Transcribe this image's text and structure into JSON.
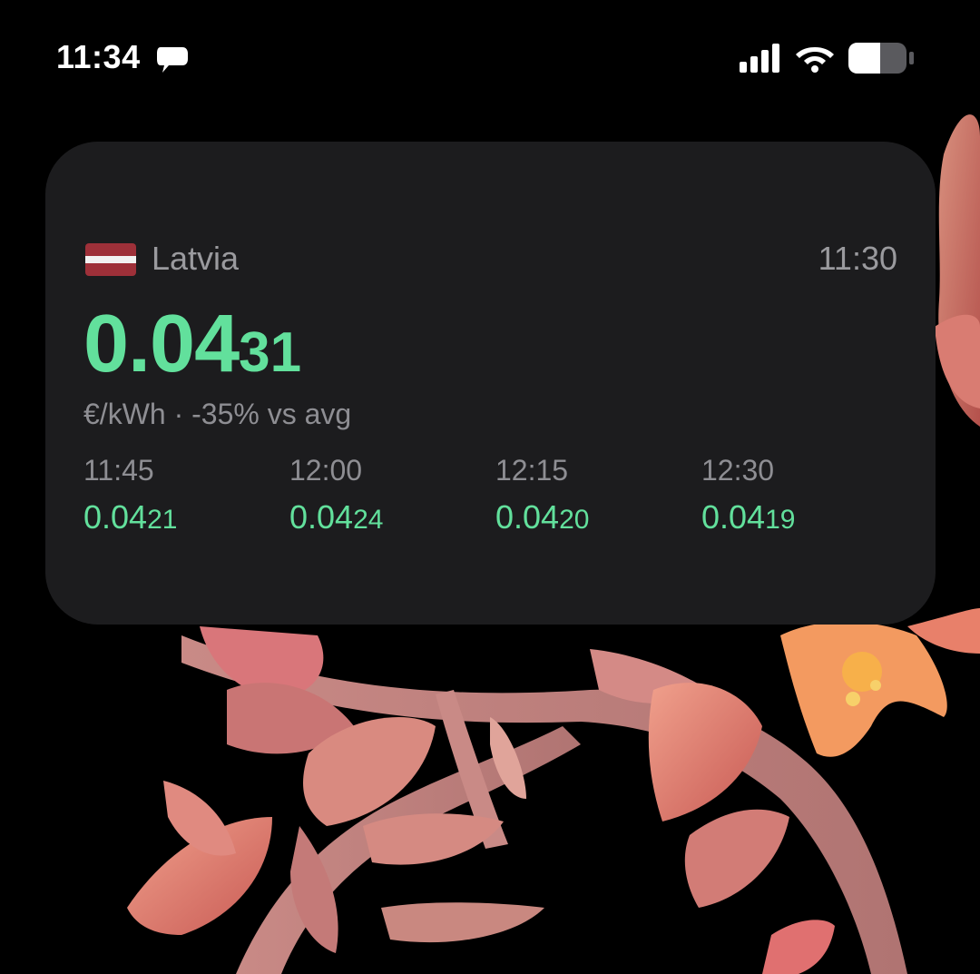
{
  "status_bar": {
    "time": "11:34",
    "icons": [
      "chat-bubble-icon",
      "cellular-signal-icon",
      "wifi-icon",
      "battery-icon"
    ]
  },
  "widget": {
    "flag": "latvia-flag-icon",
    "country": "Latvia",
    "updated_time": "11:30",
    "price_main": "0.04",
    "price_sub": "31",
    "unit_line": "€/kWh · -35% vs avg",
    "forecast": [
      {
        "time": "11:45",
        "price_main": "0.04",
        "price_sub": "21"
      },
      {
        "time": "12:00",
        "price_main": "0.04",
        "price_sub": "24"
      },
      {
        "time": "12:15",
        "price_main": "0.04",
        "price_sub": "20"
      },
      {
        "time": "12:30",
        "price_main": "0.04",
        "price_sub": "19"
      }
    ]
  },
  "colors": {
    "background": "#000000",
    "card": "#1c1c1e",
    "accent_green": "#62e09c",
    "muted_text": "#8e8e93",
    "flag_red": "#9e3039",
    "flag_white": "#f2f2f2"
  }
}
